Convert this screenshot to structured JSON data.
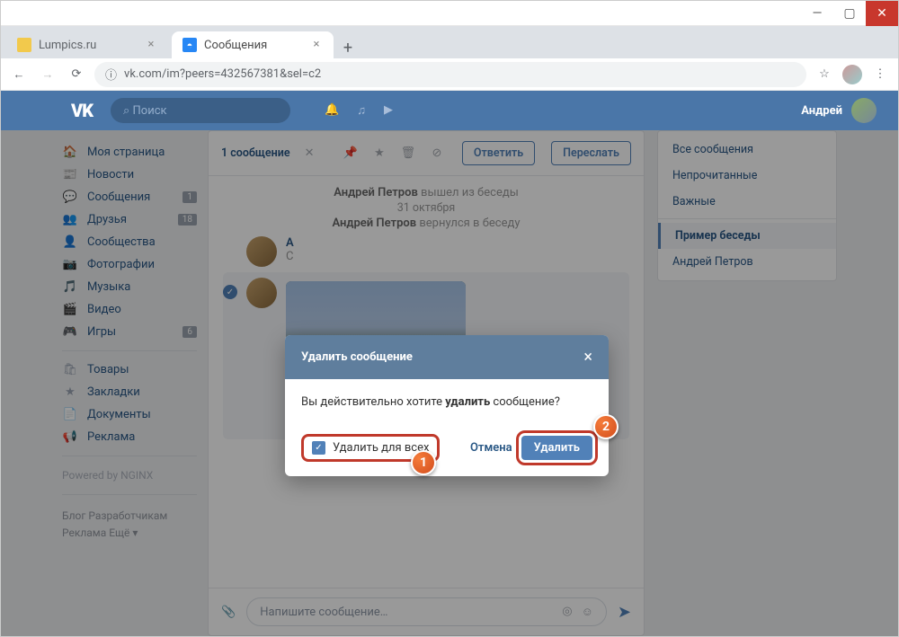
{
  "browser": {
    "tabs": [
      {
        "title": "Lumpics.ru"
      },
      {
        "title": "Сообщения"
      }
    ],
    "url": "vk.com/im?peers=432567381&sel=c2"
  },
  "header": {
    "logo": "VK",
    "search_placeholder": "Поиск",
    "user": "Андрей"
  },
  "nav": {
    "items": [
      {
        "icon": "🏠",
        "label": "Моя страница"
      },
      {
        "icon": "📰",
        "label": "Новости"
      },
      {
        "icon": "💬",
        "label": "Сообщения",
        "badge": "1"
      },
      {
        "icon": "👥",
        "label": "Друзья",
        "badge": "18"
      },
      {
        "icon": "👤",
        "label": "Сообщества"
      },
      {
        "icon": "📷",
        "label": "Фотографии"
      },
      {
        "icon": "🎵",
        "label": "Музыка"
      },
      {
        "icon": "🎬",
        "label": "Видео"
      },
      {
        "icon": "🎮",
        "label": "Игры",
        "badge": "6"
      }
    ],
    "group2": [
      {
        "icon": "🛍",
        "label": "Товары"
      },
      {
        "icon": "★",
        "label": "Закладки"
      },
      {
        "icon": "📄",
        "label": "Документы"
      },
      {
        "icon": "📢",
        "label": "Реклама"
      }
    ],
    "powered": "Powered by NGINX",
    "footer": "Блог   Разработчикам\nРеклама   Ещё ▾"
  },
  "chat": {
    "selected": "1 сообщение",
    "reply": "Ответить",
    "forward": "Переслать",
    "sys1_name": "Андрей Петров",
    "sys1_text": " вышел из беседы",
    "sys_date": "31 октября",
    "sys2_name": "Андрей Петров",
    "sys2_text": " вернулся в беседу",
    "msg1_author": "А",
    "msg1_sub": "С",
    "input_placeholder": "Напишите сообщение…"
  },
  "filters": {
    "items": [
      {
        "label": "Все сообщения"
      },
      {
        "label": "Непрочитанные"
      },
      {
        "label": "Важные"
      }
    ],
    "items2": [
      {
        "label": "Пример беседы",
        "sel": true
      },
      {
        "label": "Андрей Петров"
      }
    ]
  },
  "modal": {
    "title": "Удалить сообщение",
    "body_pre": "Вы действительно хотите ",
    "body_b": "удалить",
    "body_post": " сообщение?",
    "checkbox": "Удалить для всех",
    "cancel": "Отмена",
    "delete": "Удалить"
  },
  "ann": {
    "one": "1",
    "two": "2"
  }
}
